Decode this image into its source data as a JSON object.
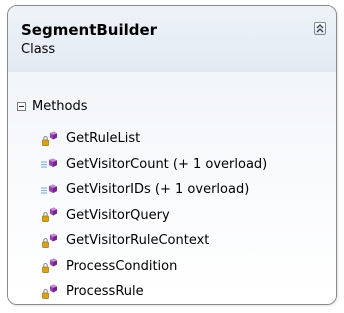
{
  "shape": {
    "title": "SegmentBuilder",
    "subtitle": "Class"
  },
  "section": {
    "label": "Methods",
    "expanded": true
  },
  "methods": [
    {
      "name": "GetRuleList",
      "access": "private",
      "icon": "private-method-icon"
    },
    {
      "name": "GetVisitorCount (+ 1 overload)",
      "access": "public",
      "icon": "public-method-icon"
    },
    {
      "name": "GetVisitorIDs (+ 1 overload)",
      "access": "public",
      "icon": "public-method-icon"
    },
    {
      "name": "GetVisitorQuery",
      "access": "private",
      "icon": "private-method-icon"
    },
    {
      "name": "GetVisitorRuleContext",
      "access": "private",
      "icon": "private-method-icon"
    },
    {
      "name": "ProcessCondition",
      "access": "private",
      "icon": "private-method-icon"
    },
    {
      "name": "ProcessRule",
      "access": "private",
      "icon": "private-method-icon"
    }
  ],
  "colors": {
    "method_icon": "#9b3fb5",
    "header_bg": "#e6edf5",
    "border": "#8a8a8a"
  }
}
